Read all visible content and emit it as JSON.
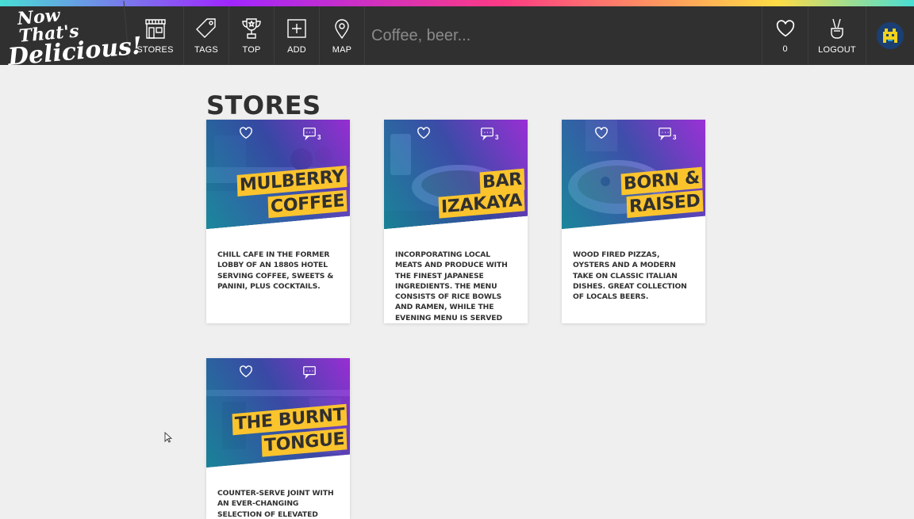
{
  "logo": {
    "line1": "Now That's",
    "line2": "Delicious!"
  },
  "nav": {
    "stores": "STORES",
    "tags": "TAGS",
    "top": "TOP",
    "add": "ADD",
    "map": "MAP",
    "search_placeholder": "Coffee, beer...",
    "hearts_count": "0",
    "logout": "LOGOUT"
  },
  "page_title": "STORES",
  "stores": [
    {
      "title_line1": "MULBERRY",
      "title_line2": "COFFEE",
      "comments": "3",
      "description": "Chill cafe in the former lobby of an 1880s hotel serving coffee, sweets & panini, plus cocktails."
    },
    {
      "title_line1": "BAR",
      "title_line2": "IZAKAYA",
      "comments": "3",
      "description": "Incorporating local meats and produce with the finest Japanese ingredients. The menu consists of rice bowls and ramen, while the evening menu is served family"
    },
    {
      "title_line1": "BORN &",
      "title_line2": "RAISED",
      "comments": "3",
      "description": "Wood fired pizzas, oysters and a modern take on classic Italian dishes. Great collection of locals beers."
    },
    {
      "title_line1": "THE BURNT",
      "title_line2": "TONGUE",
      "comments": "",
      "description": "Counter-serve joint with an ever-changing selection of elevated soups, plus burgers"
    }
  ],
  "colors": {
    "nav_bg": "#303030",
    "title_highlight": "#fbc42d",
    "page_bg": "#efefef"
  }
}
